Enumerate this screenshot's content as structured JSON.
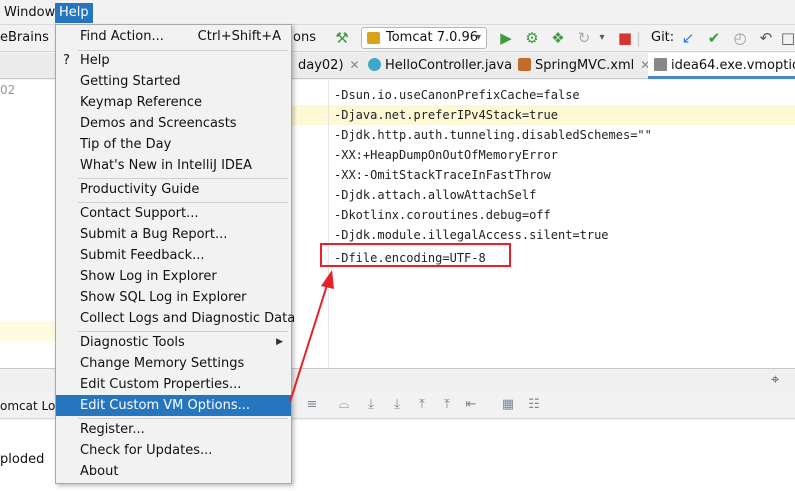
{
  "menubar": {
    "window": "Window",
    "help": "Help"
  },
  "toolbar": {
    "breadcrumb_fragment": "eBrains",
    "options_fragment": "ons",
    "run_config": "Tomcat 7.0.96",
    "git_label": "Git:"
  },
  "tabs": [
    {
      "label": "day02)"
    },
    {
      "label": "HelloController.java"
    },
    {
      "label": "SpringMVC.xml"
    },
    {
      "label": "idea64.exe.vmoptions"
    }
  ],
  "gutter": {
    "fragment": "02"
  },
  "editor": {
    "lines": [
      "-Dsun.io.useCanonPrefixCache=false",
      "-Djava.net.preferIPv4Stack=true",
      "-Djdk.http.auth.tunneling.disabledSchemes=\"\"",
      "-XX:+HeapDumpOnOutOfMemoryError",
      "-XX:-OmitStackTraceInFastThrow",
      "-Djdk.attach.allowAttachSelf",
      "-Dkotlinx.coroutines.debug=off",
      "-Djdk.module.illegalAccess.silent=true",
      "-Dfile.encoding=UTF-8"
    ]
  },
  "help_menu": {
    "find_action": "Find Action...",
    "find_action_shortcut": "Ctrl+Shift+A",
    "help": "Help",
    "getting_started": "Getting Started",
    "keymap_reference": "Keymap Reference",
    "demos": "Demos and Screencasts",
    "tip_of_day": "Tip of the Day",
    "whats_new": "What's New in IntelliJ IDEA",
    "productivity_guide": "Productivity Guide",
    "contact_support": "Contact Support...",
    "submit_bug": "Submit a Bug Report...",
    "submit_feedback": "Submit Feedback...",
    "show_log": "Show Log in Explorer",
    "show_sql_log": "Show SQL Log in Explorer",
    "collect_logs": "Collect Logs and Diagnostic Data",
    "diagnostic_tools": "Diagnostic Tools",
    "change_memory": "Change Memory Settings",
    "edit_custom_properties": "Edit Custom Properties...",
    "edit_custom_vm": "Edit Custom VM Options...",
    "register": "Register...",
    "check_updates": "Check for Updates...",
    "about": "About"
  },
  "bottom": {
    "tab_fragment": "omcat Loca",
    "log_fragment": "ploded"
  },
  "colors": {
    "highlight": "#2675bf",
    "annotation_red": "#e8202a",
    "run_green": "#3c9c3c"
  }
}
